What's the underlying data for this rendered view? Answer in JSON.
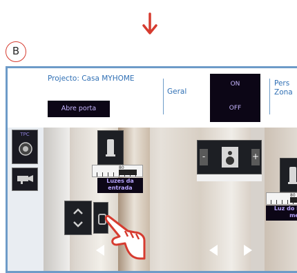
{
  "step_badge": "B",
  "header": {
    "project_title": "Projecto: Casa MYHOME",
    "open_door_label": "Abre porta",
    "general_label": "Geral",
    "on_label": "ON",
    "off_label": "OFF",
    "zone_label_line1": "Pers",
    "zone_label_line2": "Zona"
  },
  "sidebar": {
    "button1_label": "TPC"
  },
  "widgets": {
    "entrance_lights_line1": "Luzes da",
    "entrance_lights_line2": "entrada",
    "table_light_line1": "Luz do lad",
    "table_light_line2": "mesa",
    "speaker_minus": "-",
    "speaker_plus": "+",
    "ruler_value_1": "80",
    "ruler_value_2": "80"
  },
  "colors": {
    "accent_red": "#d63b2f",
    "frame_blue": "#6d9bc8",
    "header_text": "#2f6fb4",
    "dark_button": "#0c0616",
    "button_text": "#c7b6ff"
  },
  "icons": [
    "down-arrow-icon",
    "lamp-icon",
    "speaker-icon",
    "camera-icon",
    "phone-icon",
    "pointing-hand-icon",
    "left-arrow-icon",
    "right-arrow-icon",
    "up-chevron-icon",
    "down-chevron-icon"
  ]
}
